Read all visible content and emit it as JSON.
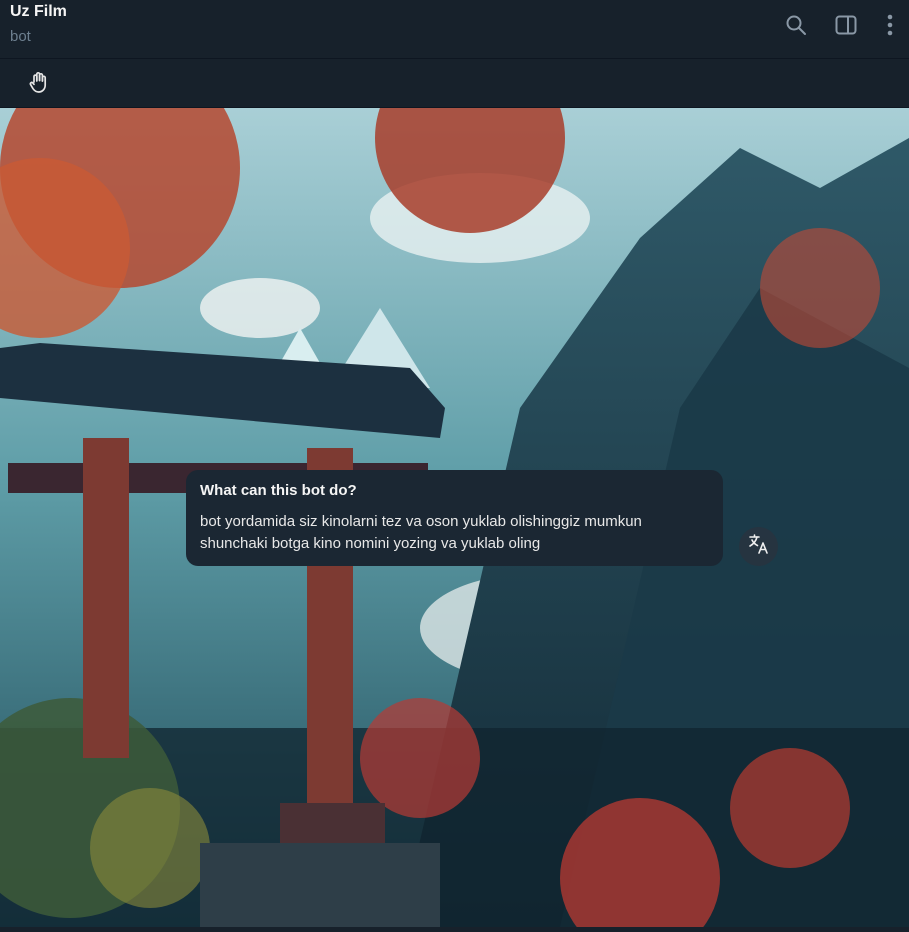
{
  "header": {
    "title": "Uz Film",
    "subtitle": "bot",
    "icons": [
      "search-icon",
      "sidebar-toggle-icon",
      "more-vertical-icon"
    ]
  },
  "pinned_bar": {
    "icon": "wave-hand-icon"
  },
  "bot_info": {
    "heading": "What can this bot do?",
    "lines": [
      "bot yordamida siz kinolarni tez va oson yuklab olishinggiz mumkun",
      "shunchaki botga kino nomini yozing va yuklab oling"
    ],
    "translate_icon": "translate-icon"
  },
  "colors": {
    "header_bg": "#17212b",
    "bubble_bg": "#1b2733",
    "subtitle": "#6d7f8f",
    "text": "#f5f5f5"
  }
}
